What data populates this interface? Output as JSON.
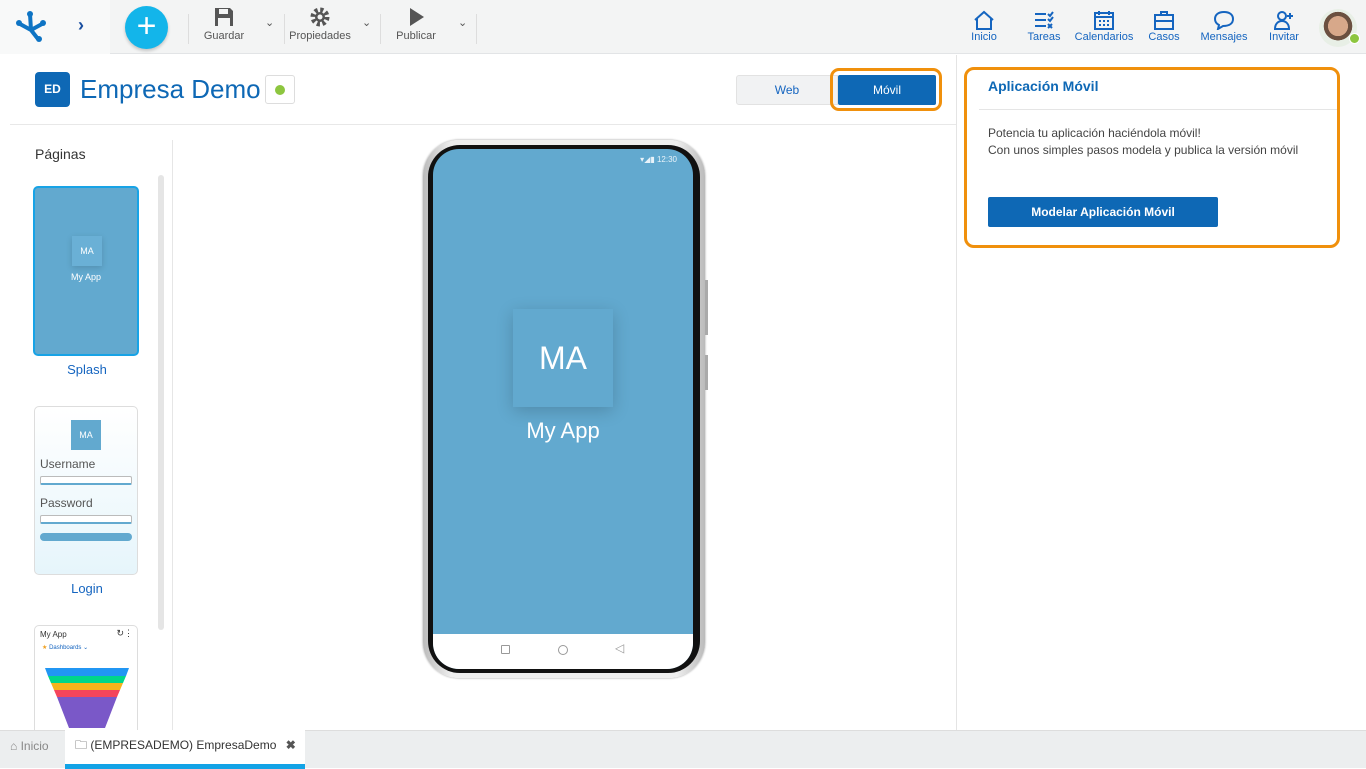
{
  "toolbar": {
    "save": "Guardar",
    "properties": "Propiedades",
    "publish": "Publicar"
  },
  "nav": [
    {
      "label": "Inicio",
      "icon": "home-icon"
    },
    {
      "label": "Tareas",
      "icon": "tasks-icon"
    },
    {
      "label": "Calendarios",
      "icon": "calendar-icon"
    },
    {
      "label": "Casos",
      "icon": "briefcase-icon"
    },
    {
      "label": "Mensajes",
      "icon": "chat-icon"
    },
    {
      "label": "Invitar",
      "icon": "invite-user-icon"
    }
  ],
  "project": {
    "initials": "ED",
    "title": "Empresa Demo",
    "status_color": "#8dc63f"
  },
  "view_toggle": {
    "web": "Web",
    "mobile": "Móvil",
    "selected": "Móvil"
  },
  "pages": {
    "heading": "Páginas",
    "items": [
      {
        "label": "Splash",
        "thumb_initials": "MA",
        "thumb_name": "My App"
      },
      {
        "label": "Login",
        "thumb_initials": "MA",
        "username": "Username",
        "password": "Password"
      },
      {
        "label": "",
        "thumb_title": "My App",
        "thumb_menu": "Dashboards"
      }
    ]
  },
  "phone": {
    "time": "12:30",
    "initials": "MA",
    "app_name": "My App"
  },
  "panel": {
    "title": "Aplicación Móvil",
    "line1": "Potencia tu aplicación haciéndola móvil!",
    "line2": "Con unos simples pasos modela y publica la versión móvil",
    "button": "Modelar Aplicación Móvil"
  },
  "footer": {
    "home_tab": "Inicio",
    "doc_tab": "(EMPRESADEMO) EmpresaDemo"
  },
  "colors": {
    "accent": "#0e68b5",
    "highlight": "#f0900c",
    "splash": "#62a9cf",
    "fab": "#13b5ea"
  }
}
